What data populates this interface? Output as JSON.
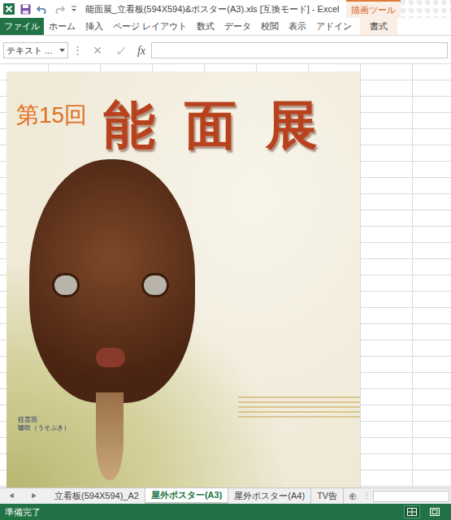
{
  "window": {
    "title": "能面展_立看板(594X594)&ポスター(A3).xls  [互換モード] - Excel",
    "context_label": "描画ツール"
  },
  "ribbon": {
    "tabs": [
      {
        "label": "ファイル",
        "kind": "file",
        "selected": false
      },
      {
        "label": "ホーム",
        "kind": "normal",
        "selected": false
      },
      {
        "label": "挿入",
        "kind": "normal",
        "selected": false
      },
      {
        "label": "ページ レイアウト",
        "kind": "normal",
        "selected": false
      },
      {
        "label": "数式",
        "kind": "normal",
        "selected": false
      },
      {
        "label": "データ",
        "kind": "normal",
        "selected": false
      },
      {
        "label": "校閲",
        "kind": "normal",
        "selected": false
      },
      {
        "label": "表示",
        "kind": "normal",
        "selected": false
      },
      {
        "label": "アドイン",
        "kind": "normal",
        "selected": false
      },
      {
        "label": "書式",
        "kind": "contextual",
        "selected": false
      }
    ]
  },
  "formula_bar": {
    "name_box": "テキスト ...",
    "separator": "⋮",
    "cancel": "×",
    "enter": "✓",
    "function": "fx"
  },
  "poster": {
    "edition": "第15回",
    "title": "能面展",
    "caption": [
      "狂言面",
      "嘘吹（うそぶき）"
    ]
  },
  "sheet_tabs": {
    "prev": "◀",
    "next": "▶",
    "add": "⊕",
    "more": "⋮",
    "tabs": [
      {
        "label": "立看板(594X594)_A2",
        "selected": false
      },
      {
        "label": "屋外ポスター(A3)",
        "selected": true
      },
      {
        "label": "屋外ポスター(A4)",
        "selected": false
      },
      {
        "label": "TV告",
        "selected": false
      }
    ]
  },
  "status_bar": {
    "text": "準備完了",
    "views": [
      {
        "selected": true
      },
      {
        "selected": false
      }
    ]
  }
}
